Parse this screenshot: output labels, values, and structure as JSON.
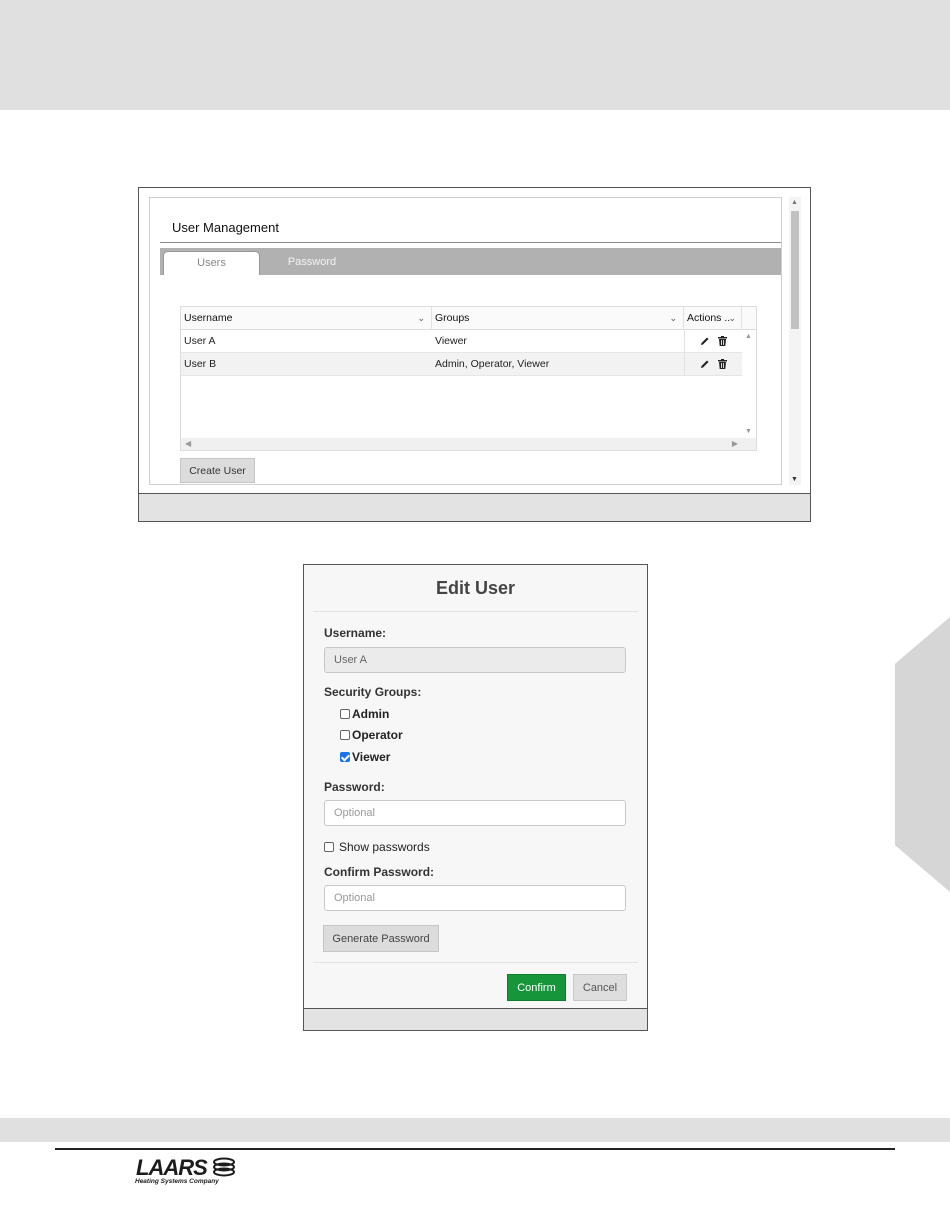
{
  "user_management": {
    "title": "User Management",
    "tabs": [
      {
        "label": "Users",
        "active": true
      },
      {
        "label": "Password",
        "active": false
      }
    ],
    "grid": {
      "columns": [
        "Username",
        "Groups",
        "Actions .."
      ],
      "rows": [
        {
          "username": "User A",
          "groups": "Viewer"
        },
        {
          "username": "User B",
          "groups": "Admin, Operator, Viewer"
        }
      ]
    },
    "create_button": "Create User"
  },
  "edit_user": {
    "title": "Edit User",
    "username_label": "Username:",
    "username_value": "User A",
    "groups_label": "Security Groups:",
    "groups": [
      {
        "label": "Admin",
        "checked": false
      },
      {
        "label": "Operator",
        "checked": false
      },
      {
        "label": "Viewer",
        "checked": true
      }
    ],
    "password_label": "Password:",
    "password_placeholder": "Optional",
    "show_passwords_label": "Show passwords",
    "show_passwords_checked": false,
    "confirm_label": "Confirm Password:",
    "confirm_placeholder": "Optional",
    "generate_button": "Generate Password",
    "confirm_button": "Confirm",
    "cancel_button": "Cancel"
  },
  "footer": {
    "logo_text": "LAARS",
    "logo_tagline": "Heating Systems Company"
  },
  "colors": {
    "confirm_green": "#16953a",
    "checkbox_blue": "#1a73e8",
    "band_gray": "#e1e0e0"
  }
}
